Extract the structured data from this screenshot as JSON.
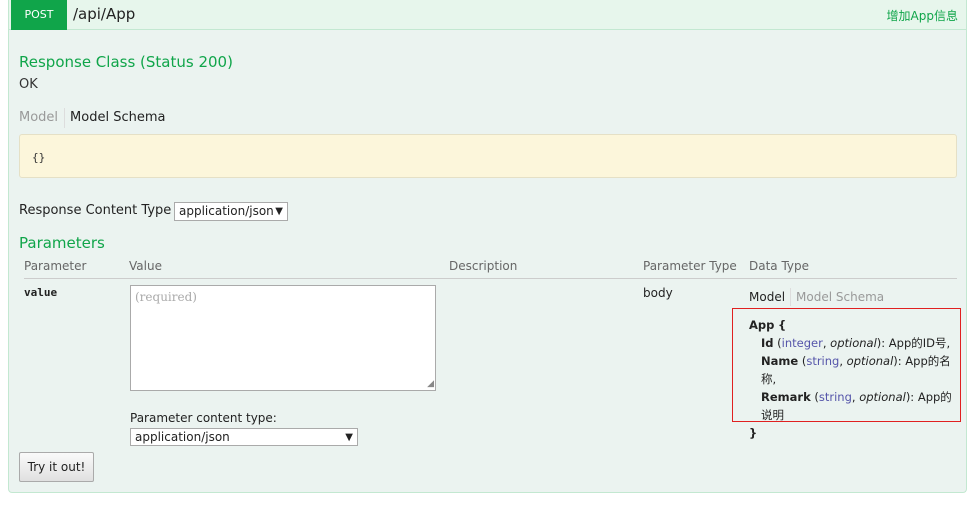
{
  "operation": {
    "method": "POST",
    "path": "/api/App",
    "summary": "增加App信息"
  },
  "response_class": {
    "title": "Response Class (Status 200)",
    "status_text": "OK",
    "tabs": [
      "Model",
      "Model Schema"
    ],
    "schema": "{}"
  },
  "response_content_type": {
    "label": "Response Content Type",
    "selected": "application/json"
  },
  "parameters": {
    "title": "Parameters",
    "columns": [
      "Parameter",
      "Value",
      "Description",
      "Parameter Type",
      "Data Type"
    ],
    "rows": [
      {
        "name": "value",
        "placeholder": "(required)",
        "param_type": "body",
        "data_type_tabs": [
          "Model",
          "Model Schema"
        ],
        "model": {
          "name": "App",
          "open": "{",
          "close": "}",
          "fields": [
            {
              "name": "Id",
              "type": "integer",
              "optional": "optional",
              "desc": "App的ID号",
              "sep": ","
            },
            {
              "name": "Name",
              "type": "string",
              "optional": "optional",
              "desc": "App的名称",
              "sep": ","
            },
            {
              "name": "Remark",
              "type": "string",
              "optional": "optional",
              "desc": "App的说明",
              "sep": ""
            }
          ]
        },
        "content_type_label": "Parameter content type:",
        "content_type_selected": "application/json"
      }
    ]
  },
  "try_button": "Try it out!",
  "colors": {
    "accent": "#10a54a",
    "header_bg": "#e7f6ec",
    "body_bg": "#ebf3f0",
    "schema_bg": "#fcf6db",
    "highlight_border": "#e02020"
  }
}
